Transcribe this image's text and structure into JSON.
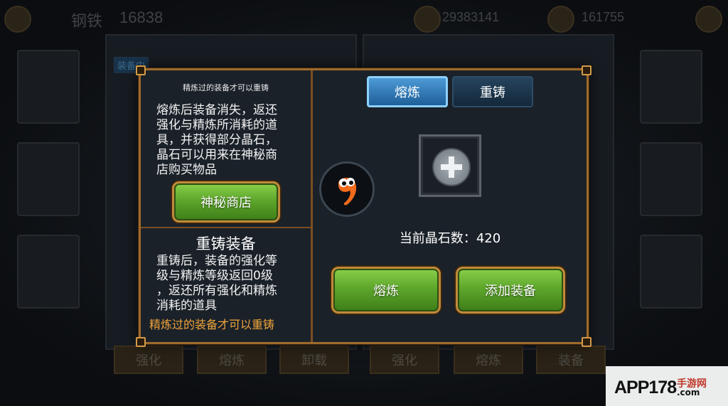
{
  "background": {
    "player_name": "钢铁",
    "player_id": "16838",
    "gold": "29383141",
    "gems": "161755",
    "equip_tag": "装备中",
    "bottom_buttons": [
      "强化",
      "熔炼",
      "卸载",
      "强化",
      "熔炼",
      "装备"
    ]
  },
  "dialog": {
    "smelt_section": {
      "caption": "精炼过的装备才可以重铸",
      "description": [
        "熔炼后装备消失，返还",
        "强化与精炼所消耗的道",
        "具，并获得部分晶石，",
        "晶石可以用来在神秘商",
        "店购买物品"
      ],
      "shop_button": "神秘商店"
    },
    "recast_section": {
      "title": "重铸装备",
      "description": [
        "重铸后，装备的强化等",
        "级与精炼等级返回0级",
        "，返还所有强化和精炼",
        "消耗的道具"
      ],
      "warning": "精炼过的装备才可以重铸"
    },
    "tabs": [
      {
        "label": "熔炼",
        "active": true
      },
      {
        "label": "重铸",
        "active": false
      }
    ],
    "crystal_label": "当前晶石数：",
    "crystal_count": "420",
    "smelt_button": "熔炼",
    "add_equip_button": "添加装备"
  },
  "watermark": {
    "main": "APP178",
    "sub": "手游网",
    "domain": ".com"
  },
  "colors": {
    "accent_border": "#a06a2a",
    "warning": "#f0a43a",
    "tab_active": "#4d9ad6",
    "button_green": "#5ea72c"
  }
}
